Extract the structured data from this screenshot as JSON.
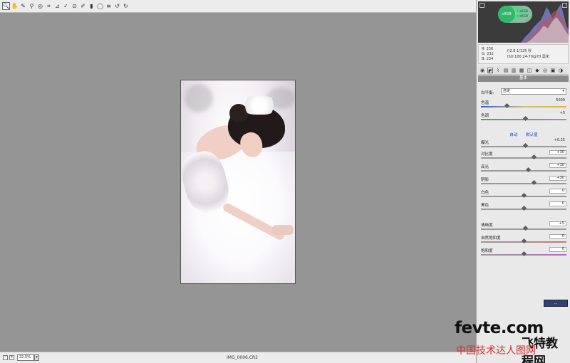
{
  "toolbar": {
    "tools": [
      {
        "name": "zoom-tool",
        "glyph": "🔍",
        "active": true
      },
      {
        "name": "hand-tool",
        "glyph": "✋"
      },
      {
        "name": "white-balance-tool",
        "glyph": "✎"
      },
      {
        "name": "color-sampler-tool",
        "glyph": "⚲"
      },
      {
        "name": "targeted-adjustment-tool",
        "glyph": "◎"
      },
      {
        "name": "crop-tool",
        "glyph": "⌗"
      },
      {
        "name": "straighten-tool",
        "glyph": "⊿"
      },
      {
        "name": "spot-removal-tool",
        "glyph": "✓"
      },
      {
        "name": "red-eye-tool",
        "glyph": "⊙"
      },
      {
        "name": "adjustment-brush-tool",
        "glyph": "✐"
      },
      {
        "name": "graduated-filter-tool",
        "glyph": "▮"
      },
      {
        "name": "radial-filter-tool",
        "glyph": "◯"
      },
      {
        "name": "preferences-tool",
        "glyph": "≡"
      },
      {
        "name": "rotate-left-tool",
        "glyph": "↺"
      },
      {
        "name": "rotate-right-tool",
        "glyph": "↻"
      }
    ],
    "preview_label": "预览"
  },
  "status": {
    "zoom": "22.5%",
    "filename": "IMG_0006.CR2"
  },
  "histogram": {
    "srgb_label": "sRGB",
    "legend_line1": "• sRGB",
    "legend_line2": "• sRGB"
  },
  "readout": {
    "r": "R: 236",
    "g": "G: 232",
    "b": "B: 234",
    "camera_line1": "f/2.8   1/125 秒",
    "camera_line2": "ISO 100   24-70@70 毫米"
  },
  "panel": {
    "title": "基本",
    "white_balance_label": "白平衡:",
    "white_balance_value": "自定",
    "auto_label": "自动",
    "default_label": "默认值",
    "sliders": [
      {
        "id": "temperature",
        "label": "色温",
        "value": "5000",
        "pos": 0.3,
        "track": "temp",
        "boxed": false
      },
      {
        "id": "tint",
        "label": "色调",
        "value": "+5",
        "pos": 0.52,
        "track": "tint",
        "boxed": false
      },
      {
        "id": "exposure",
        "label": "曝光",
        "value": "+0.25",
        "pos": 0.52,
        "track": "",
        "boxed": false
      },
      {
        "id": "contrast",
        "label": "对比度",
        "value": "+30",
        "pos": 0.62,
        "track": "",
        "boxed": true
      },
      {
        "id": "highlights",
        "label": "高光",
        "value": "+10",
        "pos": 0.55,
        "track": "",
        "boxed": true
      },
      {
        "id": "shadows",
        "label": "阴影",
        "value": "+30",
        "pos": 0.62,
        "track": "",
        "boxed": true
      },
      {
        "id": "whites",
        "label": "白色",
        "value": "0",
        "pos": 0.5,
        "track": "",
        "boxed": true
      },
      {
        "id": "blacks",
        "label": "黑色",
        "value": "0",
        "pos": 0.5,
        "track": "",
        "boxed": true
      },
      {
        "id": "clarity",
        "label": "清晰度",
        "value": "+5",
        "pos": 0.52,
        "track": "",
        "boxed": true
      },
      {
        "id": "vibrance",
        "label": "自然饱和度",
        "value": "0",
        "pos": 0.5,
        "track": "vib",
        "boxed": true
      },
      {
        "id": "saturation",
        "label": "饱和度",
        "value": "0",
        "pos": 0.5,
        "track": "sat",
        "boxed": true
      }
    ],
    "footer_label": "..."
  },
  "watermark": {
    "main": "fevte.com",
    "cn1": "飞特教程网",
    "cn2": "中国技术达人图网"
  }
}
